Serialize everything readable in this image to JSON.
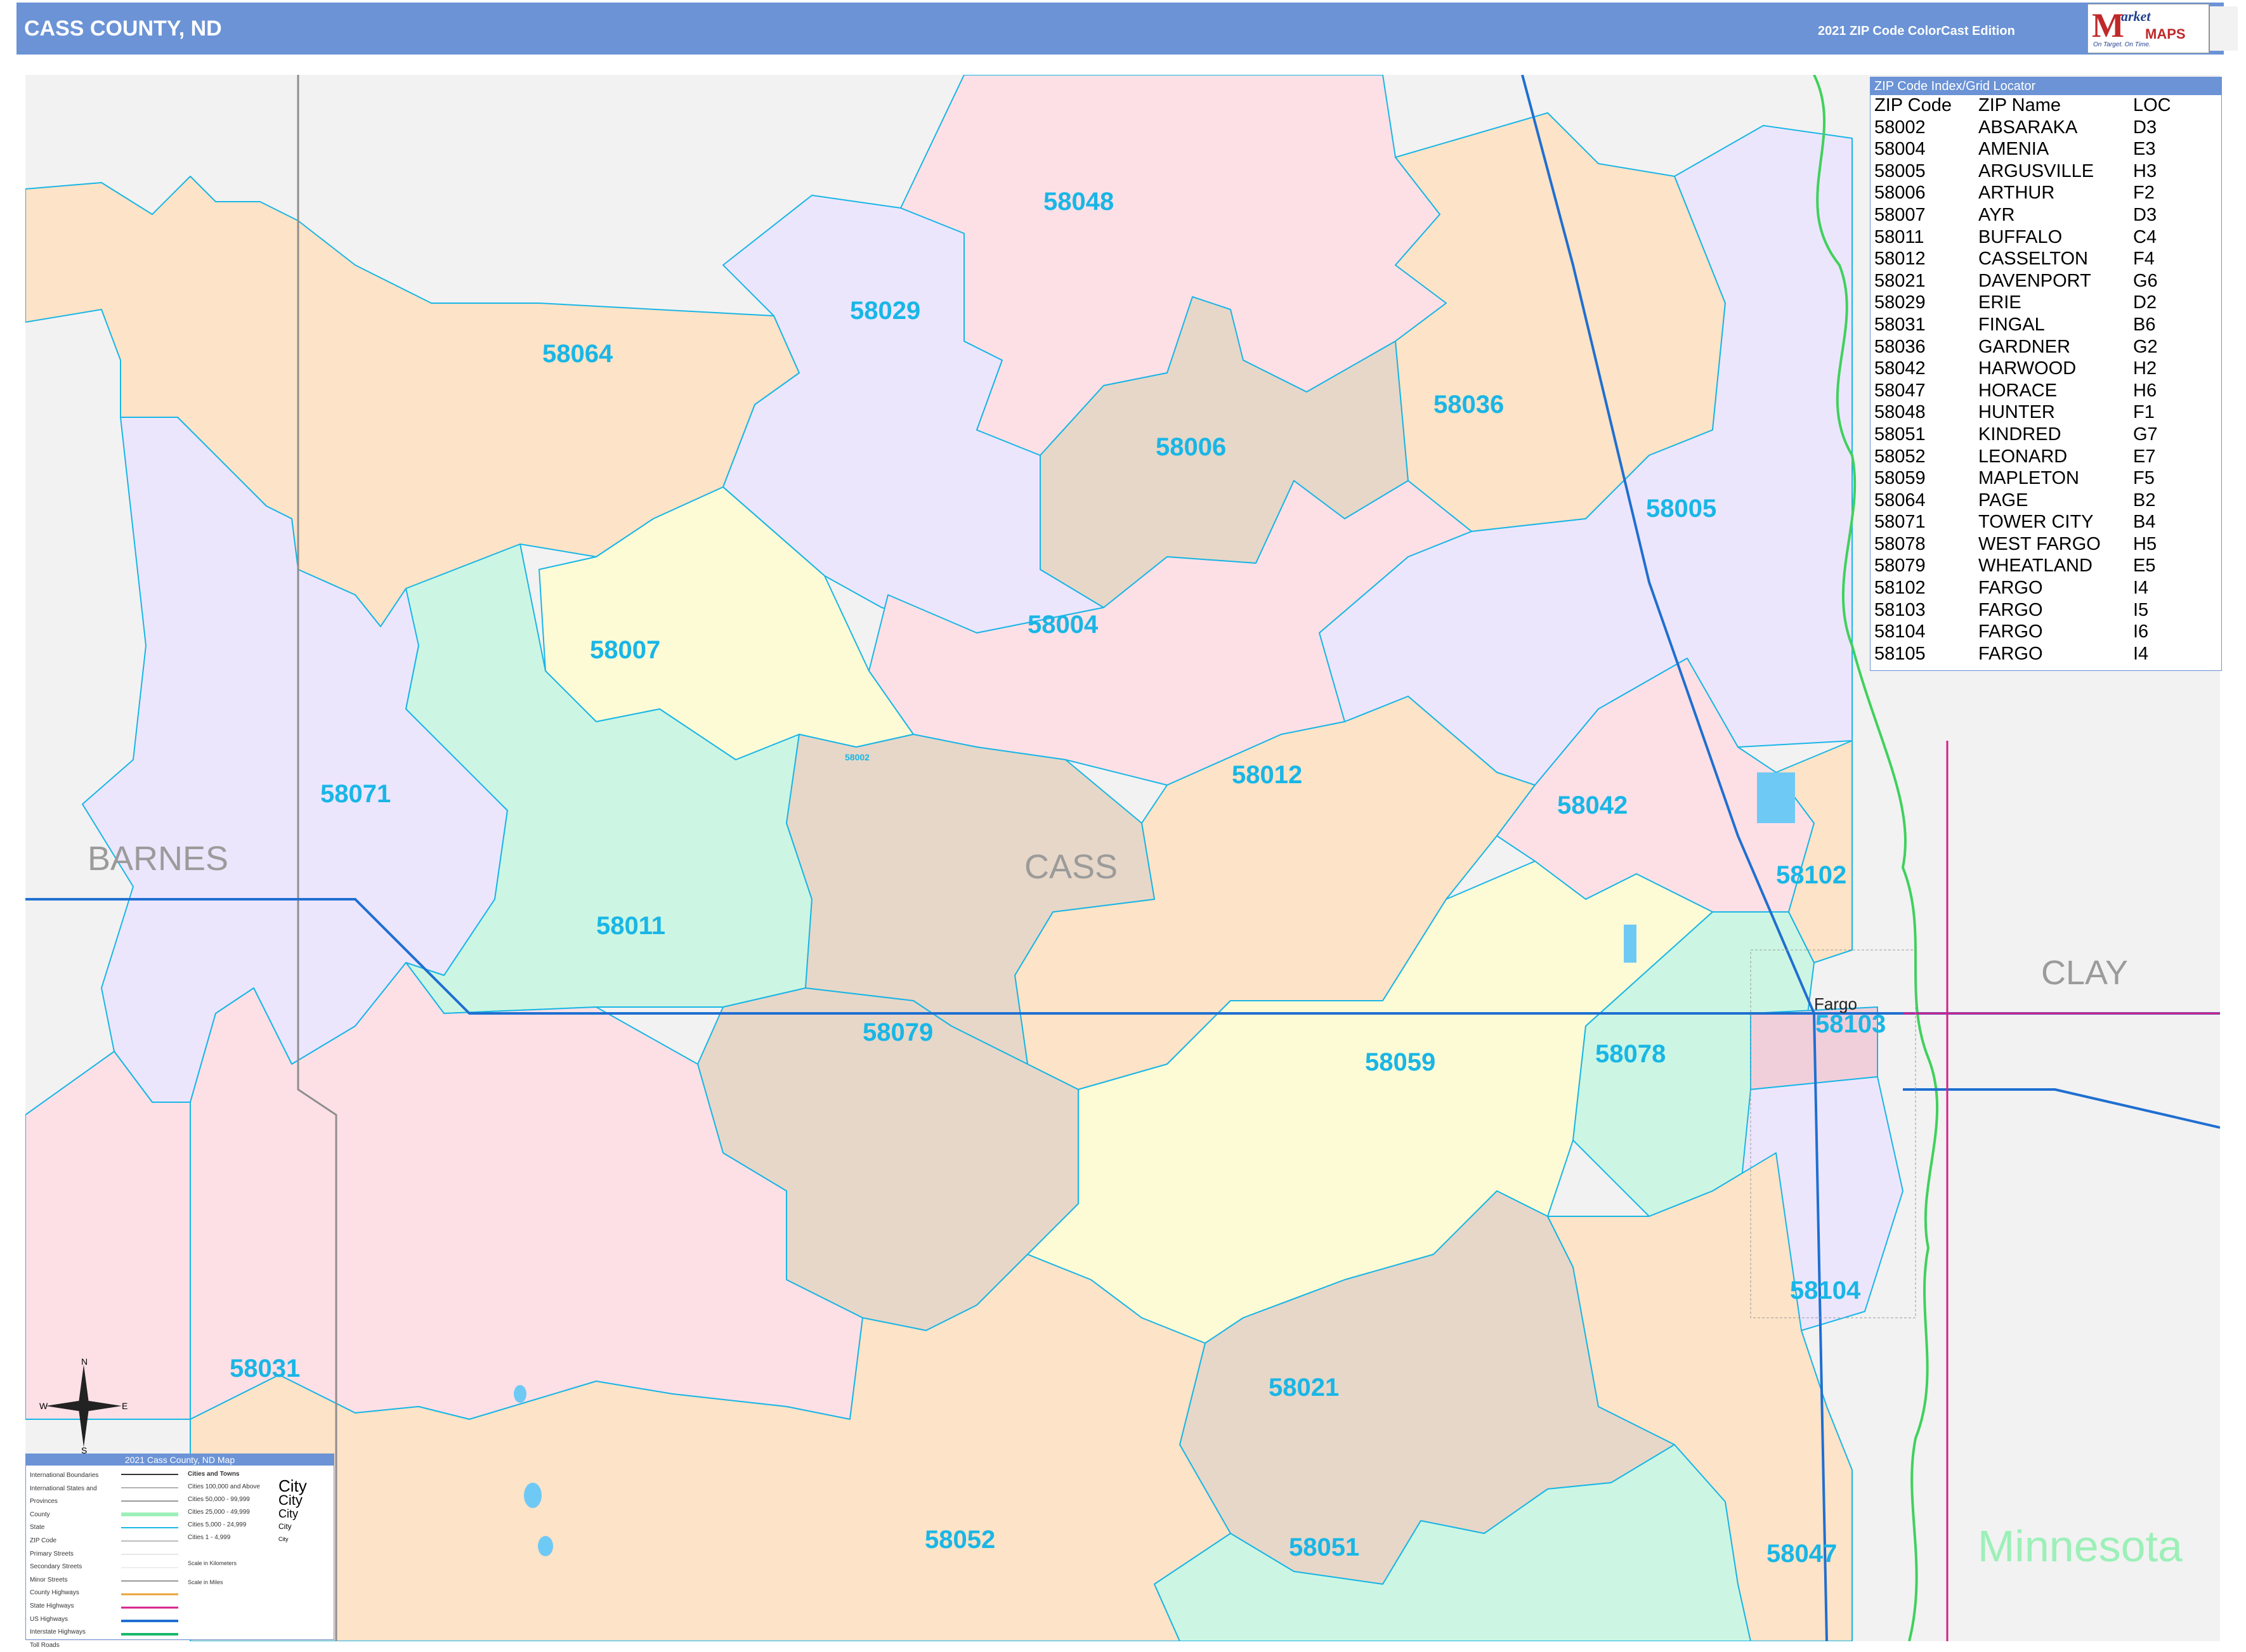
{
  "header": {
    "title": "CASS COUNTY, ND",
    "edition": "2021 ZIP Code ColorCast Edition",
    "logo_brand": "arket",
    "logo_sub": "MAPS",
    "logo_tagline": "On Target. On Time."
  },
  "index": {
    "title": "ZIP Code Index/Grid Locator",
    "columns": [
      "ZIP Code",
      "ZIP Name",
      "LOC"
    ],
    "rows": [
      [
        "58002",
        "ABSARAKA",
        "D3"
      ],
      [
        "58004",
        "AMENIA",
        "E3"
      ],
      [
        "58005",
        "ARGUSVILLE",
        "H3"
      ],
      [
        "58006",
        "ARTHUR",
        "F2"
      ],
      [
        "58007",
        "AYR",
        "D3"
      ],
      [
        "58011",
        "BUFFALO",
        "C4"
      ],
      [
        "58012",
        "CASSELTON",
        "F4"
      ],
      [
        "58021",
        "DAVENPORT",
        "G6"
      ],
      [
        "58029",
        "ERIE",
        "D2"
      ],
      [
        "58031",
        "FINGAL",
        "B6"
      ],
      [
        "58036",
        "GARDNER",
        "G2"
      ],
      [
        "58042",
        "HARWOOD",
        "H2"
      ],
      [
        "58047",
        "HORACE",
        "H6"
      ],
      [
        "58048",
        "HUNTER",
        "F1"
      ],
      [
        "58051",
        "KINDRED",
        "G7"
      ],
      [
        "58052",
        "LEONARD",
        "E7"
      ],
      [
        "58059",
        "MAPLETON",
        "F5"
      ],
      [
        "58064",
        "PAGE",
        "B2"
      ],
      [
        "58071",
        "TOWER CITY",
        "B4"
      ],
      [
        "58078",
        "WEST FARGO",
        "H5"
      ],
      [
        "58079",
        "WHEATLAND",
        "E5"
      ],
      [
        "58102",
        "FARGO",
        "I4"
      ],
      [
        "58103",
        "FARGO",
        "I5"
      ],
      [
        "58104",
        "FARGO",
        "I6"
      ],
      [
        "58105",
        "FARGO",
        "I4"
      ]
    ]
  },
  "map": {
    "regions": [
      "BARNES",
      "CASS",
      "CLAY"
    ],
    "state": "Minnesota",
    "cities": [
      "Fargo"
    ],
    "zip_labels": [
      "58048",
      "58029",
      "58064",
      "58036",
      "58006",
      "58005",
      "58004",
      "58007",
      "58012",
      "58042",
      "58071",
      "58102",
      "58011",
      "58079",
      "58059",
      "58078",
      "58103",
      "58104",
      "58031",
      "58021",
      "58052",
      "58051",
      "58047",
      "58002"
    ],
    "colors": {
      "peach": "#fde3c7",
      "pink": "#fde0e6",
      "lavender": "#ece6fd",
      "mint": "#ccf6e3",
      "yellow": "#fdfbd6",
      "tan": "#e7d7c8",
      "outside": "#f2f2f2",
      "zip_label": "#19b6e6",
      "boundary": "#19b6e6",
      "interstate": "#1f6fd1",
      "river": "#3fd15c"
    }
  },
  "legend": {
    "title": "2021 Cass County, ND Map",
    "items": [
      "International Boundaries",
      "International States and Provinces",
      "County",
      "State",
      "ZIP Code",
      "Primary Streets",
      "Secondary Streets",
      "Minor Streets",
      "County Highways",
      "State Highways",
      "US Highways",
      "Interstate Highways",
      "Toll Roads"
    ],
    "city_header": "Cities and Towns",
    "city_sizes": [
      "Cities 100,000 and Above",
      "Cities 50,000 - 99,999",
      "Cities 25,000 - 49,999",
      "Cities 5,000 - 24,999",
      "Cities 1 - 4,999"
    ],
    "city_samples": [
      "City",
      "City",
      "City",
      "City",
      "City"
    ],
    "scale_km": "Scale in Kilometers",
    "scale_mi": "Scale in Miles"
  },
  "compass": {
    "n": "N",
    "s": "S",
    "e": "E",
    "w": "W"
  }
}
